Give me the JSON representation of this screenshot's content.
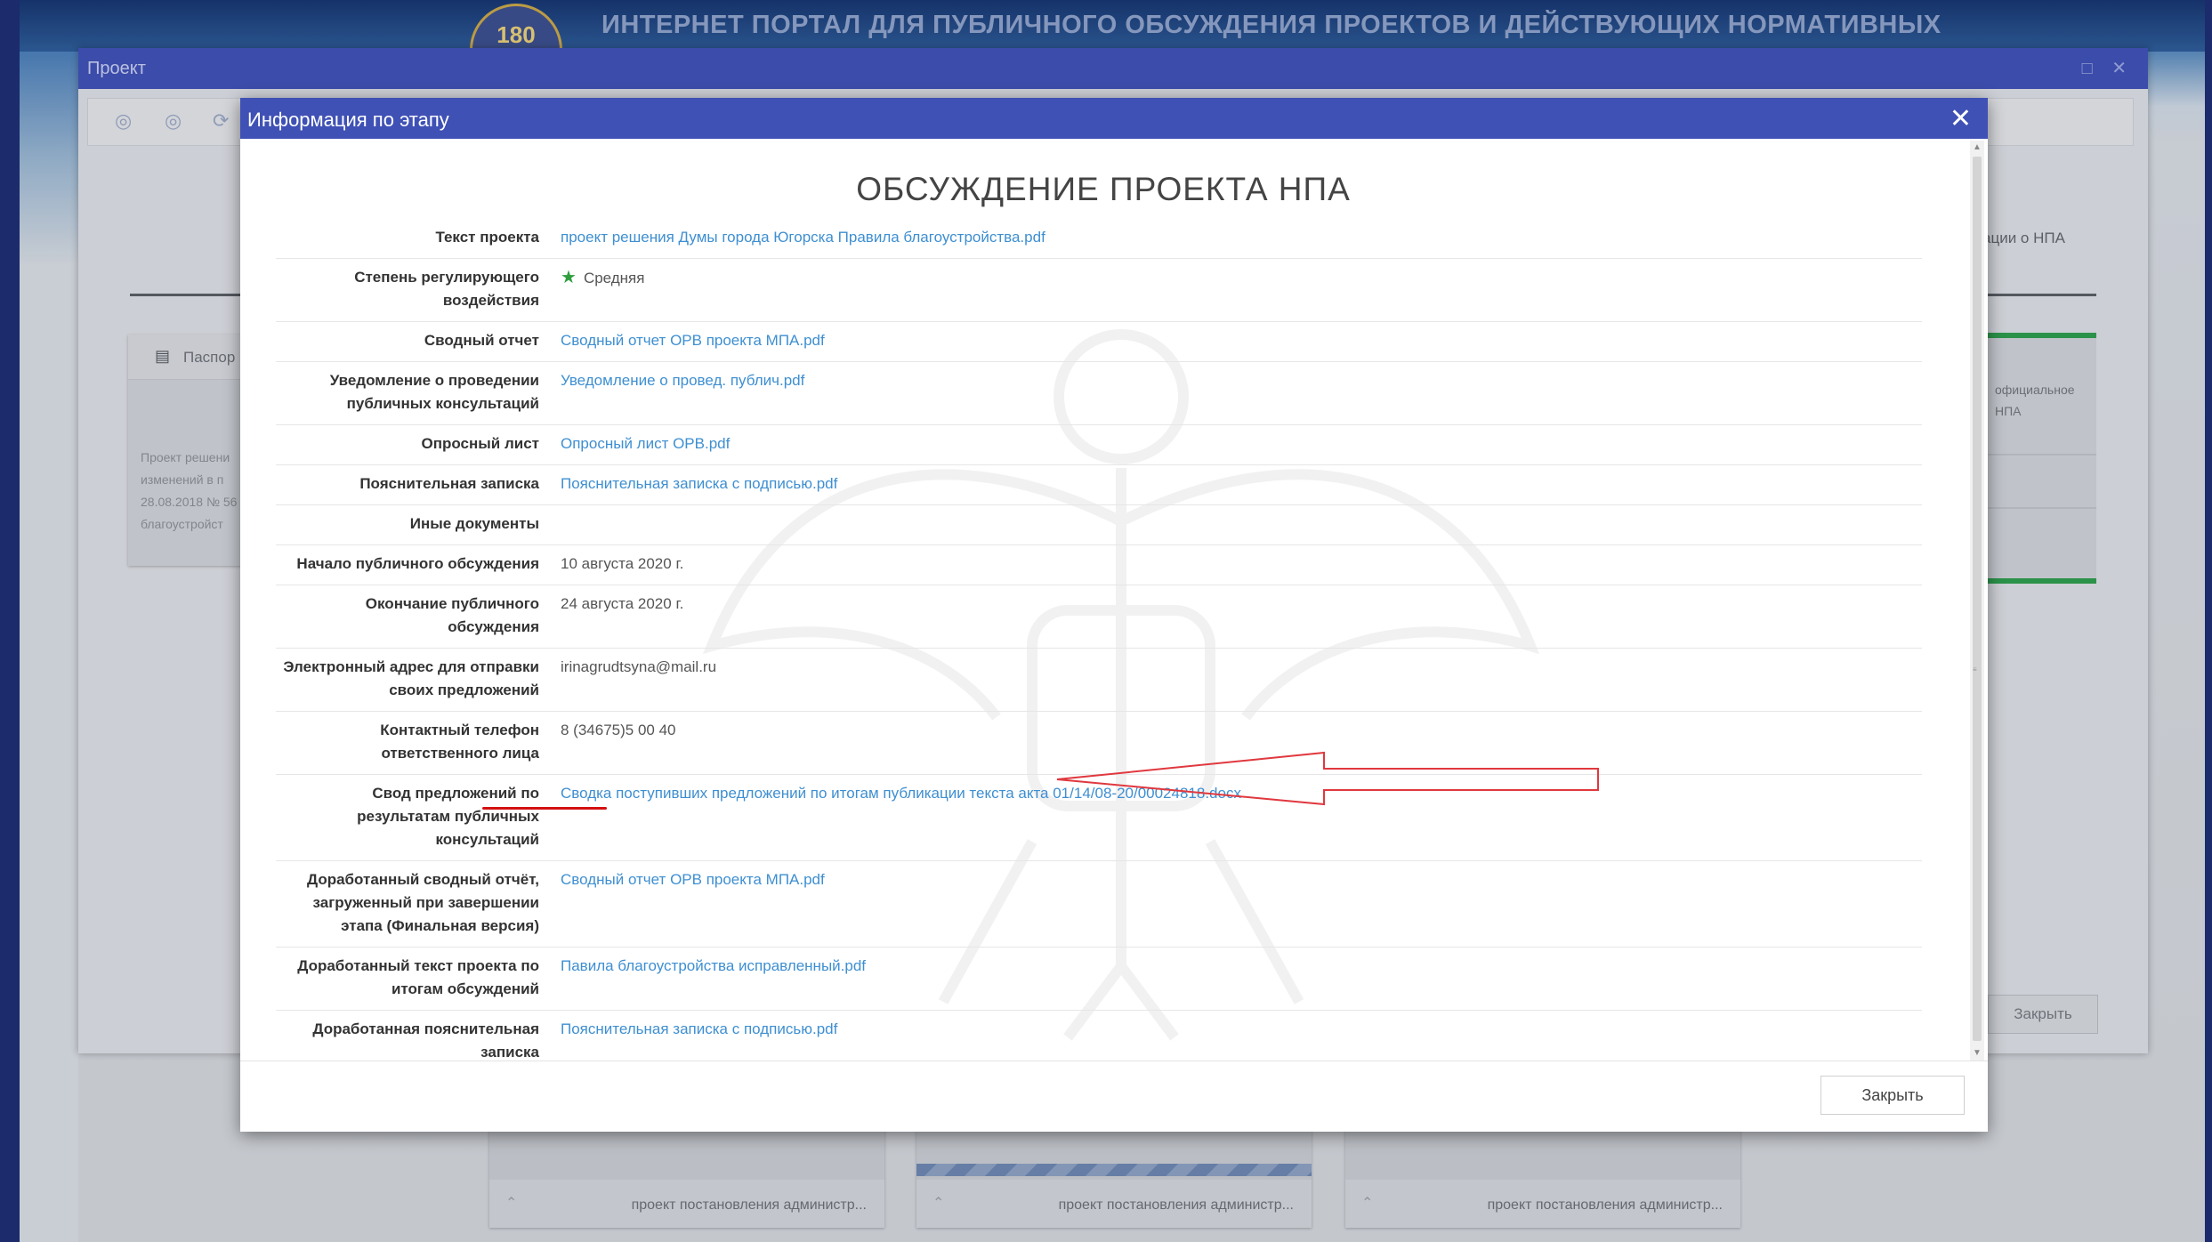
{
  "portal": {
    "title": "ИНТЕРНЕТ ПОРТАЛ ДЛЯ ПУБЛИЧНОГО ОБСУЖДЕНИЯ ПРОЕКТОВ И ДЕЙСТВУЮЩИХ НОРМАТИВНЫХ",
    "emblem_text": "180"
  },
  "project_window": {
    "title": "Проект",
    "controls": "□ ✕",
    "left_card_label": "Паспор",
    "left_card_text": "Проект решени изменений в п 28.08.2018 № 56 благоустройст",
    "right_snippet": "ации о НПА",
    "right_card_text": "официальное НПА",
    "close_label": "Закрыть"
  },
  "bottom_cards": [
    {
      "text": "проект постановления администр..."
    },
    {
      "text": "проект постановления администр..."
    },
    {
      "text": "проект постановления администр..."
    }
  ],
  "dialog": {
    "title": "Информация по этапу",
    "close_icon": "✕",
    "stage_title": "ОБСУЖДЕНИЕ ПРОЕКТА НПА",
    "footer_close_label": "Закрыть",
    "rows": [
      {
        "label": "Текст проекта",
        "value": "проект решения Думы города Югорска Правила благоустройства.pdf"
      },
      {
        "label": "Степень регулирующего воздействия",
        "value": "Средняя"
      },
      {
        "label": "Сводный отчет",
        "value": "Сводный отчет ОРВ проекта МПА.pdf"
      },
      {
        "label": "Уведомление о проведении публичных консультаций",
        "value": "Уведомление о провед. публич.pdf"
      },
      {
        "label": "Опросный лист",
        "value": "Опросный лист ОРВ.pdf"
      },
      {
        "label": "Пояснительная записка",
        "value": "Пояснительная записка с подписью.pdf"
      },
      {
        "label": "Иные документы",
        "value": ""
      },
      {
        "label": "Начало публичного обсуждения",
        "value": "10 августа 2020 г."
      },
      {
        "label": "Окончание публичного обсуждения",
        "value": "24 августа 2020 г."
      },
      {
        "label": "Электронный адрес для отправки своих предложений",
        "value": "irinagrudtsyna@mail.ru"
      },
      {
        "label": "Контактный телефон ответственного лица",
        "value": "8 (34675)5 00 40"
      },
      {
        "label": "Свод предложений по результатам публичных консультаций",
        "value": "Сводка поступивших предложений по итогам публикации текста акта 01/14/08-20/00024818.docx"
      },
      {
        "label": "Доработанный сводный отчёт, загруженный при завершении этапа (Финальная версия)",
        "value": "Сводный отчет ОРВ проекта МПА.pdf"
      },
      {
        "label": "Доработанный текст проекта по итогам обсуждений",
        "value": "Павила благоустройства исправленный.pdf"
      },
      {
        "label": "Доработанная пояснительная записка",
        "value": "Пояснительная записка с подписью.pdf"
      }
    ]
  },
  "colors": {
    "titlebar": "#3f51b5",
    "link": "#3e8fd1",
    "annotation_red": "#d41010",
    "star_green": "#2e9e3e"
  }
}
